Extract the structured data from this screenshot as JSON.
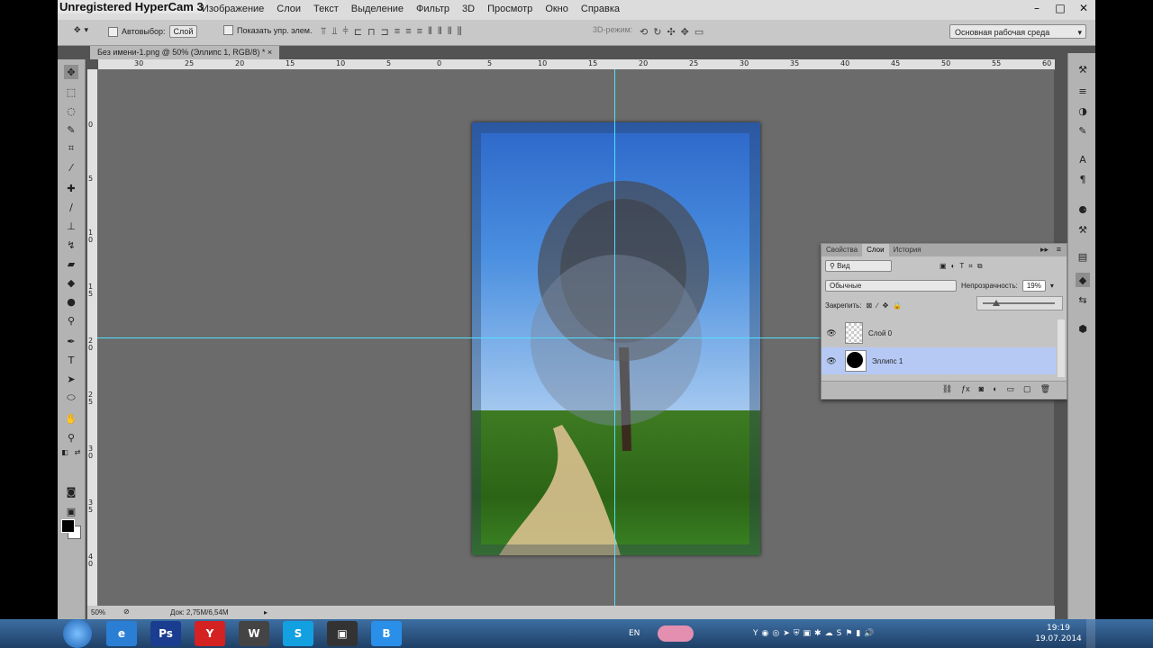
{
  "watermark": "Unregistered HyperCam 3",
  "menu": [
    "Изображение",
    "Слои",
    "Текст",
    "Выделение",
    "Фильтр",
    "3D",
    "Просмотр",
    "Окно",
    "Справка"
  ],
  "window_controls": {
    "minimize": "–",
    "maximize": "□",
    "close": "✕"
  },
  "options_bar": {
    "autoselect_label": "Автовыбор:",
    "autoselect_value": "Слой",
    "show_transform_label": "Показать упр. элем.",
    "mode_3d_label": "3D-режим:",
    "workspace": "Основная рабочая среда"
  },
  "document_tab": "Без имени-1.png @ 50% (Эллипс 1, RGB/8) *",
  "ruler_h": [
    "30",
    "25",
    "20",
    "15",
    "10",
    "5",
    "0",
    "5",
    "10",
    "15",
    "20",
    "25",
    "30",
    "35",
    "40",
    "45",
    "50",
    "55",
    "60"
  ],
  "ruler_v": [
    "0",
    "5",
    "1 0",
    "1 5",
    "2 0",
    "2 5",
    "3 0",
    "3 5",
    "4 0"
  ],
  "status": {
    "zoom": "50%",
    "doc_size": "Док: 2,75M/6,54M"
  },
  "layers_panel": {
    "tabs": [
      "Свойства",
      "Слои",
      "История"
    ],
    "active_tab": "Слои",
    "kind_filter": "Вид",
    "blend_mode": "Обычные",
    "opacity_label": "Непрозрачность:",
    "opacity_value": "19%",
    "lock_label": "Закрепить:",
    "layers": [
      {
        "name": "Слой 0",
        "selected": false
      },
      {
        "name": "Эллипс 1",
        "selected": true
      }
    ],
    "footer_icons": [
      "link-icon",
      "fx-icon",
      "mask-icon",
      "adjustment-icon",
      "group-icon",
      "new-layer-icon",
      "trash-icon"
    ]
  },
  "taskbar": {
    "apps": [
      "e",
      "Ps",
      "Y",
      "W",
      "S",
      "▣",
      "B"
    ],
    "lang": "EN",
    "time": "19:19",
    "date": "19.07.2014"
  },
  "colors": {
    "guide": "#4fe0ff",
    "selected_layer": "#b6c9f5"
  }
}
